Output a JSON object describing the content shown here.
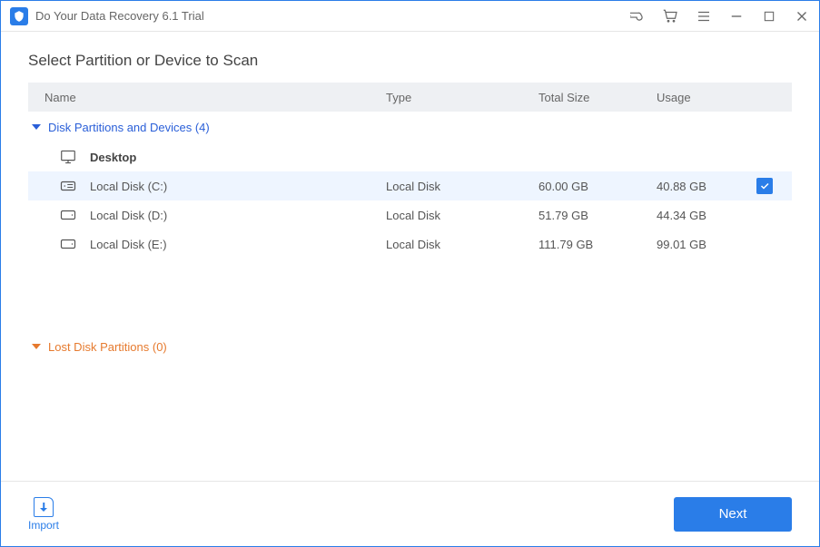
{
  "window": {
    "title": "Do Your Data Recovery 6.1 Trial"
  },
  "heading": "Select Partition or Device to Scan",
  "columns": {
    "name": "Name",
    "type": "Type",
    "size": "Total Size",
    "usage": "Usage"
  },
  "group_devices": {
    "label": "Disk Partitions and Devices (4)"
  },
  "group_lost": {
    "label": "Lost Disk Partitions (0)"
  },
  "rows": [
    {
      "name": "Desktop",
      "type": "",
      "size": "",
      "usage": "",
      "icon": "monitor",
      "bold": true,
      "selected": false,
      "checked": false
    },
    {
      "name": "Local Disk (C:)",
      "type": "Local Disk",
      "size": "60.00 GB",
      "usage": "40.88 GB",
      "icon": "disk-system",
      "bold": false,
      "selected": true,
      "checked": true
    },
    {
      "name": "Local Disk (D:)",
      "type": "Local Disk",
      "size": "51.79 GB",
      "usage": "44.34 GB",
      "icon": "disk",
      "bold": false,
      "selected": false,
      "checked": false
    },
    {
      "name": "Local Disk (E:)",
      "type": "Local Disk",
      "size": "111.79 GB",
      "usage": "99.01 GB",
      "icon": "disk",
      "bold": false,
      "selected": false,
      "checked": false
    }
  ],
  "footer": {
    "import": "Import",
    "next": "Next"
  }
}
